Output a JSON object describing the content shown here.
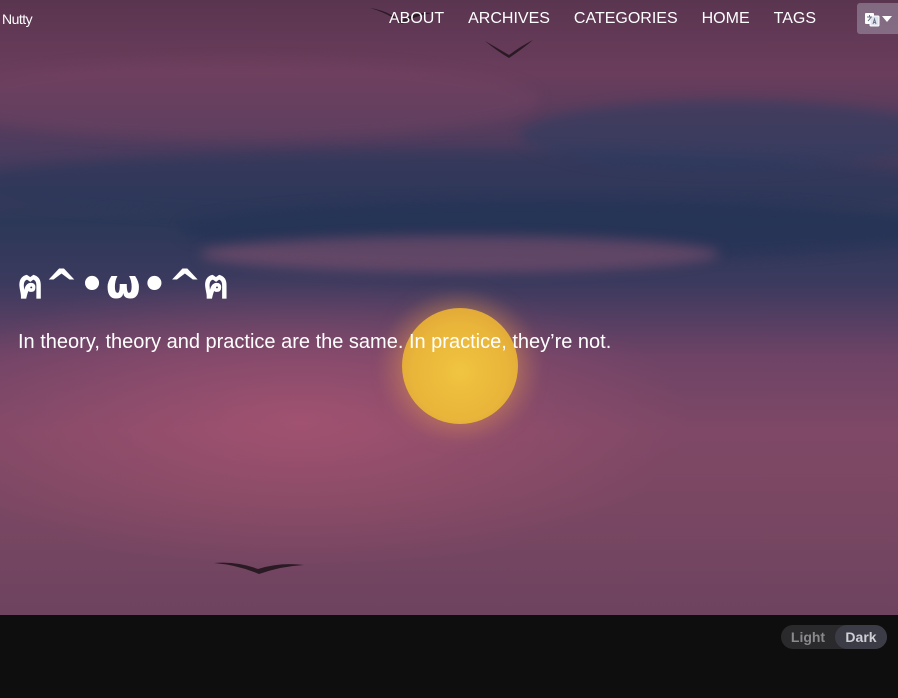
{
  "site": {
    "title": "Nutty"
  },
  "nav": {
    "items": [
      {
        "label": "ABOUT"
      },
      {
        "label": "ARCHIVES"
      },
      {
        "label": "CATEGORIES"
      },
      {
        "label": "HOME"
      },
      {
        "label": "TAGS"
      }
    ],
    "language_icon": "translate-icon",
    "language_caret_icon": "caret-down-icon"
  },
  "hero": {
    "headline": "ฅ^•ω•^ฅ",
    "subtitle": "In theory, theory and practice are the same. In practice, they’re not."
  },
  "theme_toggle": {
    "light_label": "Light",
    "dark_label": "Dark",
    "selected": "Dark"
  },
  "colors": {
    "footer_bg": "#0e0e0e",
    "toggle_bg": "#2a2a2c",
    "toggle_active": "#3c3c46",
    "sun": "#e9b53a"
  }
}
